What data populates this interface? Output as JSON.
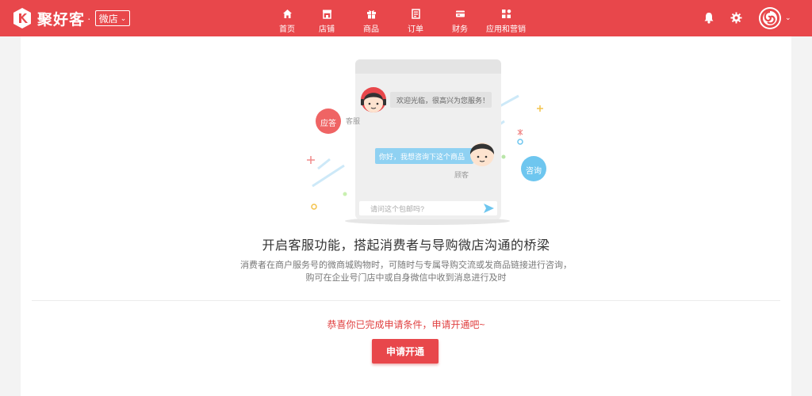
{
  "brand": {
    "name": "聚好客",
    "dot": "·"
  },
  "store_switch": {
    "label": "微店"
  },
  "nav": [
    {
      "id": "home",
      "label": "首页",
      "icon": "home-icon"
    },
    {
      "id": "shop",
      "label": "店铺",
      "icon": "shop-icon"
    },
    {
      "id": "goods",
      "label": "商品",
      "icon": "gift-icon"
    },
    {
      "id": "orders",
      "label": "订单",
      "icon": "order-icon"
    },
    {
      "id": "finance",
      "label": "财务",
      "icon": "card-icon"
    },
    {
      "id": "apps",
      "label": "应用和营销",
      "icon": "apps-icon"
    }
  ],
  "toolbar": {
    "bell": "bell-icon",
    "settings": "gear-icon",
    "avatar": "avatar"
  },
  "illustration": {
    "welcome_msg": "欢迎光临，很高兴为您服务！",
    "service_label": "客服",
    "question_msg": "你好，我想咨询下这个商品",
    "customer_label": "顾客",
    "input_placeholder": "请问这个包邮吗?",
    "reply_badge": "应答",
    "consult_badge": "咨询"
  },
  "content": {
    "headline": "开启客服功能，搭起消费者与导购微店沟通的桥梁",
    "desc_line1": "消费者在商户服务号的微商城购物时，可随时与专属导购交流或发商品链接进行咨询，",
    "desc_line2": "购可在企业号门店中或自身微信中收到消息进行及时",
    "congrats": "恭喜你已完成申请条件，申请开通吧~",
    "apply_button": "申请开通"
  },
  "colors": {
    "brand_red": "#e8474b",
    "accent_blue": "#6ec6ef",
    "bg": "#f3f3f3"
  }
}
